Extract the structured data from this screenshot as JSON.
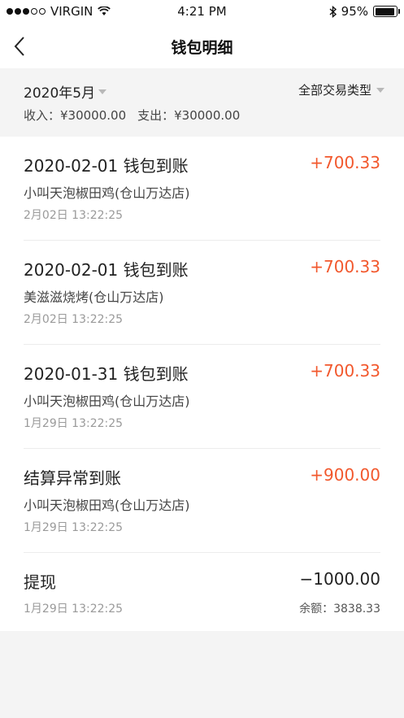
{
  "status_bar": {
    "carrier": "VIRGIN",
    "time": "4:21 PM",
    "battery": "95%",
    "battery_level": 0.95
  },
  "nav": {
    "title": "钱包明细"
  },
  "filter": {
    "month": "2020年5月",
    "type": "全部交易类型",
    "income": "收入：¥30000.00",
    "expense": "支出：¥30000.00"
  },
  "transactions": [
    {
      "title": "2020-02-01   钱包到账",
      "amount": "+700.33",
      "store": "小叫天泡椒田鸡(仓山万达店)",
      "time": "2月02日   13:22:25"
    },
    {
      "title": "2020-02-01   钱包到账",
      "amount": "+700.33",
      "store": "美滋滋烧烤(仓山万达店)",
      "time": "2月02日   13:22:25"
    },
    {
      "title": "2020-01-31   钱包到账",
      "amount": "+700.33",
      "store": "小叫天泡椒田鸡(仓山万达店)",
      "time": "1月29日   13:22:25"
    },
    {
      "title": "结算异常到账",
      "amount": "+900.00",
      "store": "小叫天泡椒田鸡(仓山万达店)",
      "time": "1月29日   13:22:25"
    },
    {
      "title": "提现",
      "amount": "−1000.00",
      "time": "1月29日   13:22:25",
      "balance": "余额：3838.33"
    }
  ],
  "colors": {
    "positive": "#f2582d",
    "negative": "#222222"
  }
}
